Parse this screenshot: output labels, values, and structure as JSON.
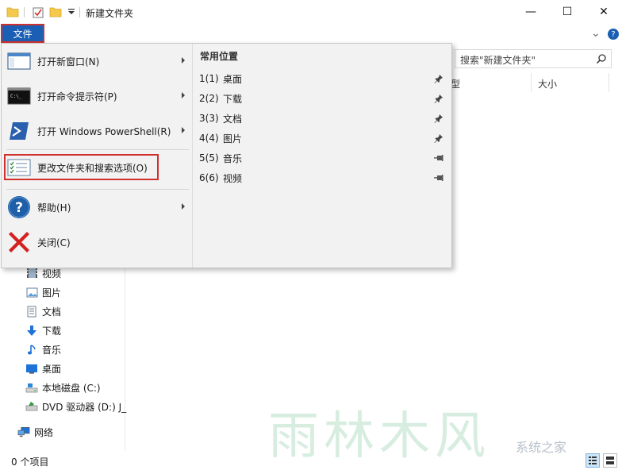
{
  "window": {
    "title": "新建文件夹",
    "minimize": "—",
    "maximize": "☐",
    "close": "✕"
  },
  "ribbon": {
    "file_tab": "文件",
    "expand": "⌄",
    "help": "?"
  },
  "search": {
    "placeholder": "搜索\"新建文件夹\""
  },
  "columns": {
    "type_partial": "型",
    "size": "大小"
  },
  "file_menu": {
    "items": [
      {
        "label": "打开新窗口(N)",
        "icon": "window-icon",
        "has_submenu": true
      },
      {
        "label": "打开命令提示符(P)",
        "icon": "cmd-icon",
        "has_submenu": true
      },
      {
        "label": "打开 Windows PowerShell(R)",
        "icon": "powershell-icon",
        "has_submenu": true
      },
      {
        "label": "更改文件夹和搜索选项(O)",
        "icon": "folder-options-icon",
        "has_submenu": false
      },
      {
        "label": "帮助(H)",
        "icon": "help-icon",
        "has_submenu": true
      },
      {
        "label": "关闭(C)",
        "icon": "close-x-icon",
        "has_submenu": false
      }
    ],
    "recent_header": "常用位置",
    "recent": [
      {
        "num": "1(1)",
        "label": "桌面",
        "pinned": true
      },
      {
        "num": "2(2)",
        "label": "下载",
        "pinned": true
      },
      {
        "num": "3(3)",
        "label": "文档",
        "pinned": true
      },
      {
        "num": "4(4)",
        "label": "图片",
        "pinned": true
      },
      {
        "num": "5(5)",
        "label": "音乐",
        "pinned": false
      },
      {
        "num": "6(6)",
        "label": "视频",
        "pinned": false
      }
    ]
  },
  "nav": {
    "items": [
      {
        "label": "视频",
        "icon": "video-icon"
      },
      {
        "label": "图片",
        "icon": "pictures-icon"
      },
      {
        "label": "文档",
        "icon": "documents-icon"
      },
      {
        "label": "下载",
        "icon": "download-icon"
      },
      {
        "label": "音乐",
        "icon": "music-icon"
      },
      {
        "label": "桌面",
        "icon": "desktop-icon"
      },
      {
        "label": "本地磁盘 (C:)",
        "icon": "disk-icon"
      },
      {
        "label": "DVD 驱动器 (D:) J_",
        "icon": "dvd-icon"
      }
    ],
    "network": "网络"
  },
  "status": {
    "items_count": "0 个项目"
  },
  "watermark": {
    "main": "雨林木风",
    "sub": "系统之家"
  },
  "colors": {
    "accent": "#1a5fb4",
    "highlight_border": "#d0312d",
    "menu_bg": "#f2f2f2"
  }
}
